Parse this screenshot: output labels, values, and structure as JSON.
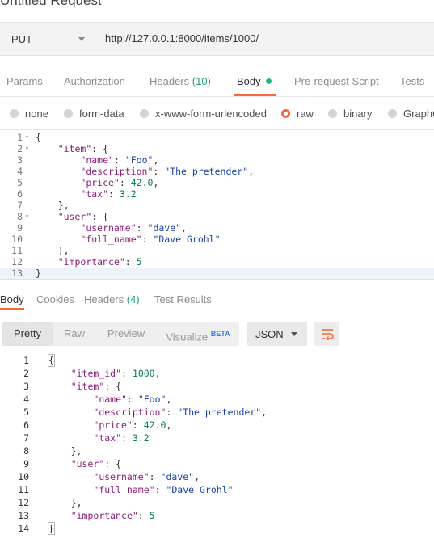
{
  "window": {
    "title": "Untitled Request"
  },
  "request": {
    "method": "PUT",
    "url": "http://127.0.0.1:8000/items/1000/"
  },
  "request_tabs": [
    {
      "label": "Params"
    },
    {
      "label": "Authorization"
    },
    {
      "label": "Headers",
      "count": "(10)"
    },
    {
      "label": "Body",
      "active": true
    },
    {
      "label": "Pre-request Script"
    },
    {
      "label": "Tests"
    }
  ],
  "body_modes": [
    {
      "label": "none"
    },
    {
      "label": "form-data"
    },
    {
      "label": "x-www-form-urlencoded"
    },
    {
      "label": "raw",
      "selected": true
    },
    {
      "label": "binary"
    },
    {
      "label": "GraphQL"
    }
  ],
  "request_body_lines": [
    "{",
    "    \"item\": {",
    "        \"name\": \"Foo\",",
    "        \"description\": \"The pretender\",",
    "        \"price\": 42.0,",
    "        \"tax\": 3.2",
    "    },",
    "    \"user\": {",
    "        \"username\": \"dave\",",
    "        \"full_name\": \"Dave Grohl\"",
    "    },",
    "    \"importance\": 5",
    "}"
  ],
  "response_tabs": [
    {
      "label": "Body",
      "active": true
    },
    {
      "label": "Cookies"
    },
    {
      "label": "Headers",
      "count": "(4)"
    },
    {
      "label": "Test Results"
    }
  ],
  "view_modes": [
    {
      "label": "Pretty",
      "active": true
    },
    {
      "label": "Raw"
    },
    {
      "label": "Preview"
    },
    {
      "label": "Visualize",
      "badge": "BETA"
    }
  ],
  "format_select": {
    "value": "JSON"
  },
  "wrap_icon": "wrap-lines-icon",
  "response_body_lines": [
    "{",
    "    \"item_id\": 1000,",
    "    \"item\": {",
    "        \"name\": \"Foo\",",
    "        \"description\": \"The pretender\",",
    "        \"price\": 42.0,",
    "        \"tax\": 3.2",
    "    },",
    "    \"user\": {",
    "        \"username\": \"dave\",",
    "        \"full_name\": \"Dave Grohl\"",
    "    },",
    "    \"importance\": 5",
    "}"
  ],
  "colors": {
    "accent": "#f26b3a",
    "active_dot": "#26b47f",
    "key": "#8a1f7a",
    "string": "#1a3fa8",
    "number": "#0c7a61"
  }
}
